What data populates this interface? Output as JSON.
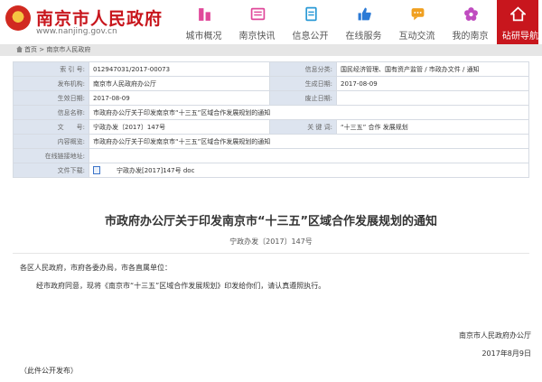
{
  "header": {
    "site_title": "南京市人民政府",
    "site_url": "www.nanjing.gov.cn",
    "nav": [
      {
        "label": "城市概况",
        "icon": "building-icon",
        "color": "#e0489a"
      },
      {
        "label": "南京快讯",
        "icon": "newspaper-icon",
        "color": "#e0489a"
      },
      {
        "label": "信息公开",
        "icon": "document-icon",
        "color": "#2b9ad6"
      },
      {
        "label": "在线服务",
        "icon": "thumbs-up-icon",
        "color": "#2b7ad6"
      },
      {
        "label": "互动交流",
        "icon": "chat-icon",
        "color": "#f0a020"
      },
      {
        "label": "我的南京",
        "icon": "flower-icon",
        "color": "#c04cc0"
      },
      {
        "label": "砧研导航",
        "icon": "home-icon",
        "color": "#ffffff"
      }
    ]
  },
  "breadcrumb": {
    "home": "首页",
    "separator": " > ",
    "current": "南京市人民政府"
  },
  "info": {
    "index_label": "索 引 号:",
    "index_value": "012947031/2017-00073",
    "category_label": "信息分类:",
    "category_value": "国民经济管理、国有资产监管 / 市政办文件 / 通知",
    "publisher_label": "发布机构:",
    "publisher_value": "南京市人民政府办公厅",
    "created_label": "生成日期:",
    "created_value": "2017-08-09",
    "effective_label": "生效日期:",
    "effective_value": "2017-08-09",
    "expire_label": "废止日期:",
    "expire_value": "",
    "name_label": "信息名称:",
    "name_value": "市政府办公厅关于印发南京市“十三五”区域合作发展规划的通知",
    "docno_label": "文　　号:",
    "docno_value": "宁政办发〔2017〕147号",
    "keywords_label": "关 键 词:",
    "keywords_value": "“十三五” 合作 发展规划",
    "summary_label": "内容概览:",
    "summary_value": "市政府办公厅关于印发南京市“十三五”区域合作发展规划的通知",
    "online_label": "在线链接地址:",
    "online_value": "",
    "download_label": "文件下载:",
    "download_value": "宁政办发[2017]147号 doc"
  },
  "article": {
    "title": "市政府办公厅关于印发南京市“十三五”区域合作发展规划的通知",
    "doc_no": "宁政办发〔2017〕147号",
    "salutation": "各区人民政府，市府各委办局，市各直属单位：",
    "body": "经市政府同意，现将《南京市“十三五”区域合作发展规划》印发给你们，请认真遵照执行。",
    "signature": "南京市人民政府办公厅",
    "date": "2017年8月9日",
    "note": "（此件公开发布）"
  }
}
